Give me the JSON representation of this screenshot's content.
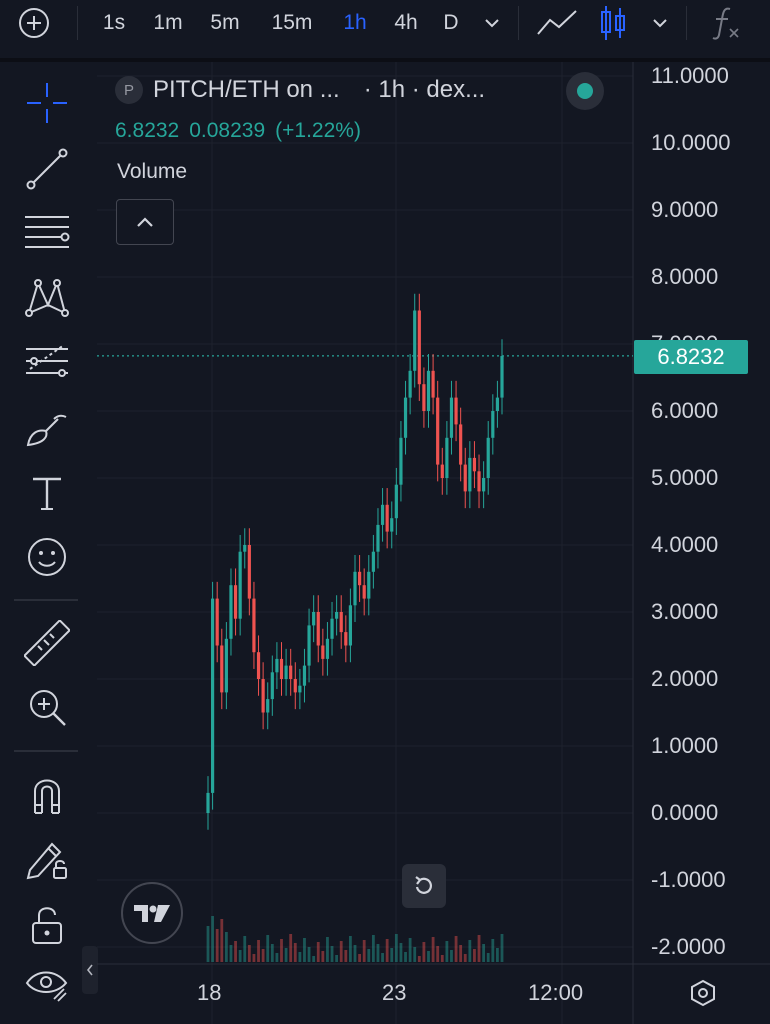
{
  "toolbar": {
    "timeframes": [
      {
        "label": "1s",
        "active": false
      },
      {
        "label": "1m",
        "active": false
      },
      {
        "label": "5m",
        "active": false
      },
      {
        "label": "15m",
        "active": false
      },
      {
        "label": "1h",
        "active": true
      },
      {
        "label": "4h",
        "active": false
      },
      {
        "label": "D",
        "active": false
      }
    ]
  },
  "legend": {
    "logo_letter": "P",
    "symbol": "PITCH/ETH on ...",
    "meta": "· 1h · dex...",
    "last": "6.8232",
    "change": "0.08239",
    "change_pct": "(+1.22%)"
  },
  "volume": {
    "label": "Volume"
  },
  "price_scale": {
    "labels": [
      "11.0000",
      "10.0000",
      "9.0000",
      "8.0000",
      "7.0000",
      "6.0000",
      "5.0000",
      "4.0000",
      "3.0000",
      "2.0000",
      "1.0000",
      "0.0000",
      "-1.0000",
      "-2.0000"
    ],
    "current": "6.8232"
  },
  "time_scale": {
    "labels": [
      "18",
      "23",
      "12:00"
    ]
  },
  "colors": {
    "up": "#26a69a",
    "down": "#ef5350",
    "accent": "#2962ff",
    "background": "#131722"
  },
  "chart_data": {
    "type": "line",
    "title": "",
    "xlabel": "",
    "ylabel": "",
    "ylim": [
      -2,
      11
    ],
    "x_ticks": [
      "18",
      "23",
      "12:00"
    ],
    "series": [
      {
        "values": [
          0.3,
          3.2,
          2.5,
          1.8,
          2.6,
          3.4,
          2.9,
          3.9,
          4.0,
          3.2,
          2.4,
          2.0,
          1.5,
          1.7,
          2.1,
          2.3,
          2.0,
          2.2,
          2.0,
          1.8,
          1.9,
          2.2,
          2.8,
          3.0,
          2.5,
          2.3,
          2.6,
          2.9,
          3.0,
          2.7,
          2.5,
          3.1,
          3.6,
          3.4,
          3.2,
          3.6,
          3.9,
          4.3,
          4.6,
          4.2,
          4.4,
          4.9,
          5.6,
          6.2,
          6.6,
          7.5,
          6.4,
          6.0,
          6.6,
          6.2,
          5.2,
          5.0,
          5.6,
          6.2,
          5.8,
          5.2,
          4.8,
          5.3,
          5.1,
          4.8,
          5.0,
          5.6,
          6.0,
          6.2,
          6.82
        ]
      }
    ]
  }
}
